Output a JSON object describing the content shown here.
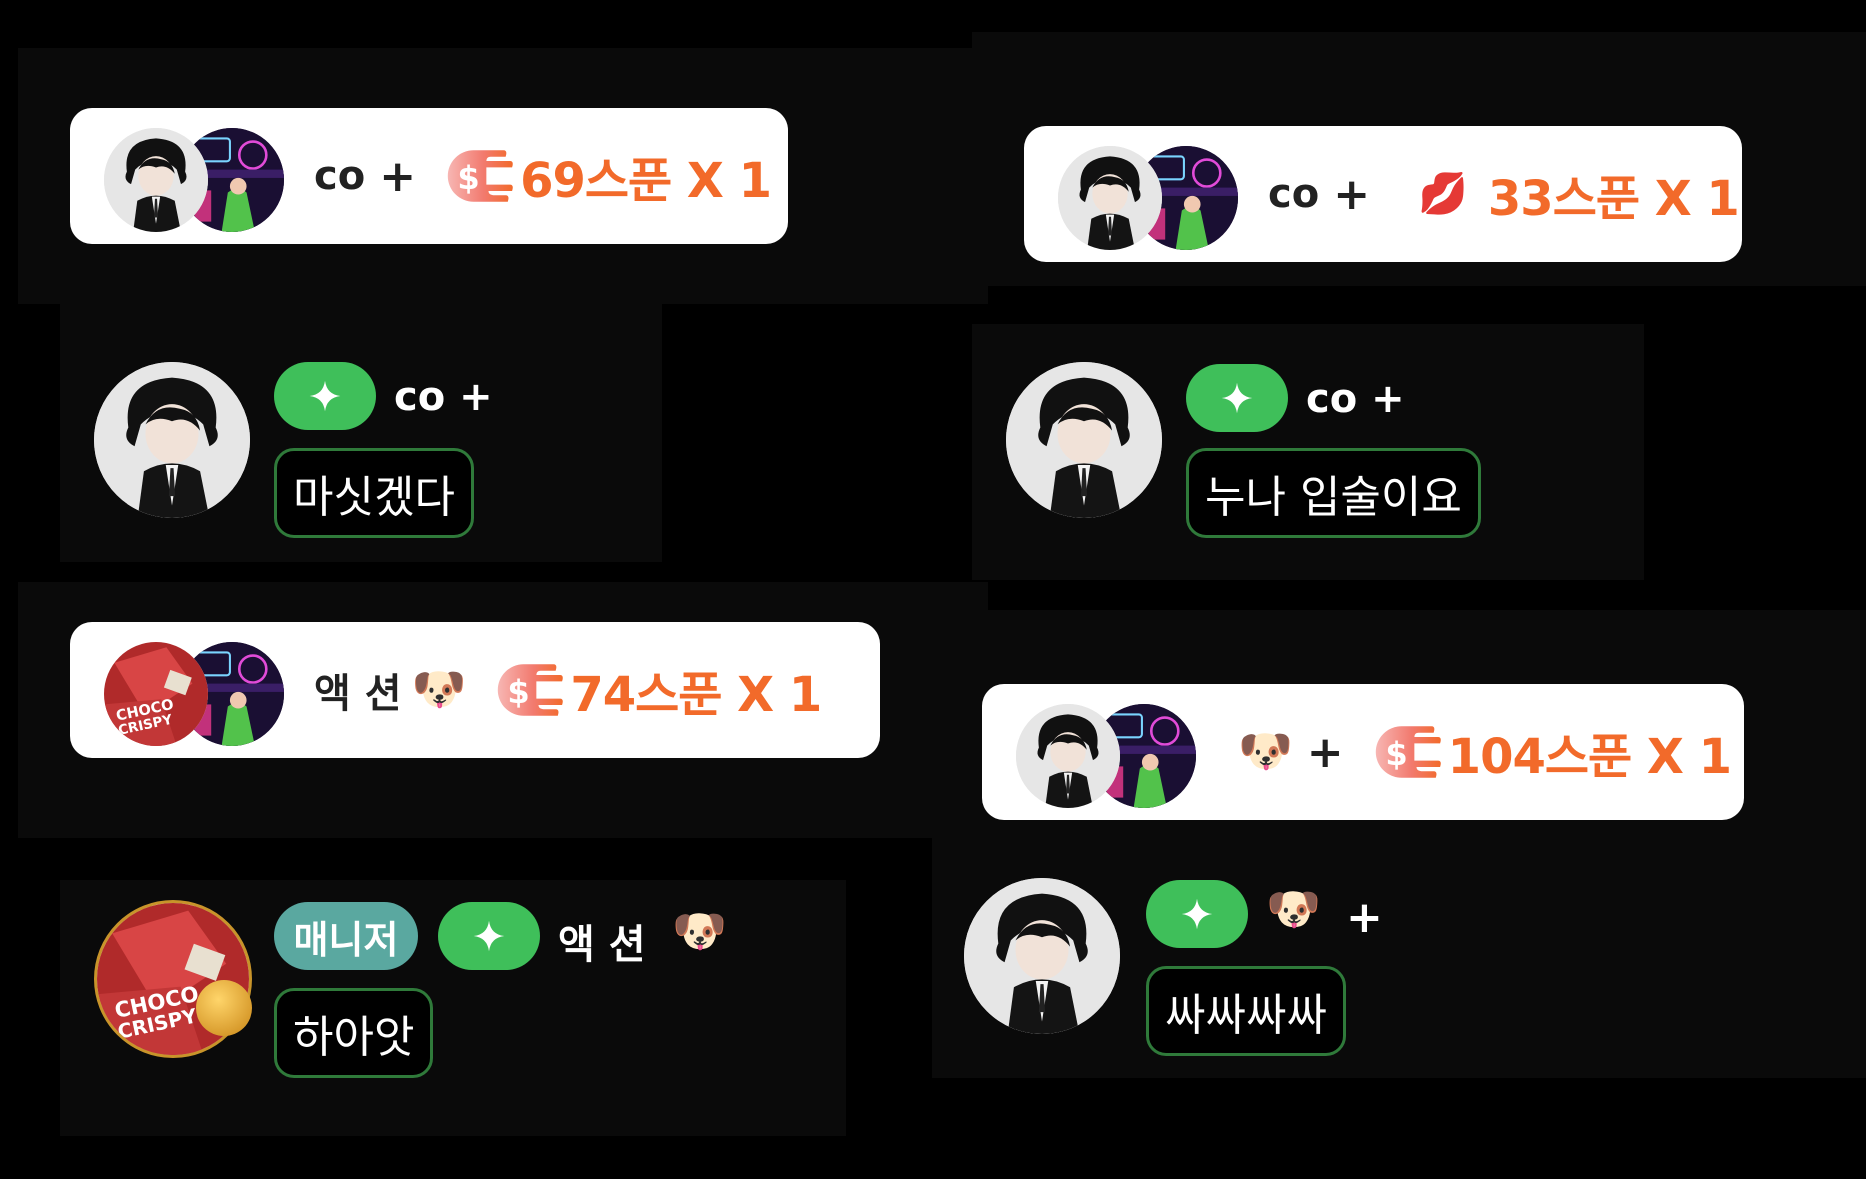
{
  "colors": {
    "background": "#000000",
    "panel": "#0a0a0a",
    "card": "#ffffff",
    "amount": "#f26a2a",
    "badge_green": "#3fbf5a",
    "badge_manager": "#5aa8a0",
    "bubble_border": "#2f7a3a"
  },
  "donations": [
    {
      "name": "co",
      "plus": "+",
      "icon": "spoon-coin-icon",
      "amount": "69스푼 X 1"
    },
    {
      "name": "co",
      "plus": "+",
      "icon": "lips-icon",
      "emoji": "💋",
      "amount": "33스푼 X 1"
    },
    {
      "name": "액 션",
      "dog": "🐶",
      "plus": "",
      "icon": "spoon-coin-icon",
      "amount": "74스푼 X 1"
    },
    {
      "name": "",
      "dog": "🐶",
      "plus": "+",
      "icon": "spoon-coin-icon",
      "amount": "104스푼 X 1"
    }
  ],
  "chats": [
    {
      "name": "co +",
      "message": "마싯겠다"
    },
    {
      "name": "co +",
      "message": "누나 입술이요"
    },
    {
      "manager_badge": "매니저",
      "name": "액 션",
      "dog": "🐶",
      "message": "하아앗"
    },
    {
      "dog": "🐶",
      "plus": "+",
      "message": "싸싸싸싸"
    }
  ]
}
